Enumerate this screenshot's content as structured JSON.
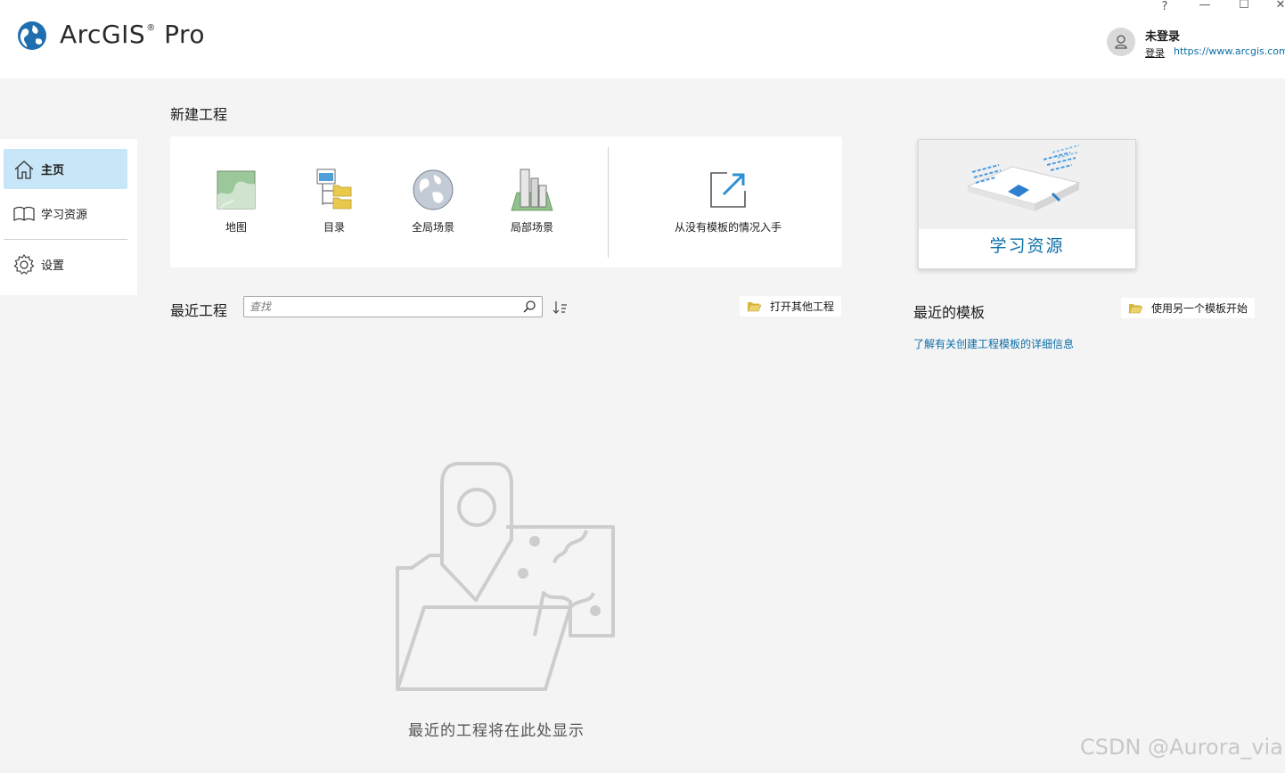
{
  "app": {
    "brand": "ArcGIS",
    "brand_mark": "®",
    "brand_suffix": "Pro"
  },
  "window": {
    "help": "?",
    "minimize": "—",
    "maximize": "☐",
    "close": "✕"
  },
  "user": {
    "status": "未登录",
    "login": "登录",
    "portal": "https://www.arcgis.com/"
  },
  "sidebar": {
    "items": [
      {
        "label": "主页",
        "icon": "home-icon"
      },
      {
        "label": "学习资源",
        "icon": "book-icon"
      },
      {
        "label": "设置",
        "icon": "gear-icon"
      }
    ]
  },
  "new_project": {
    "title": "新建工程",
    "templates": [
      {
        "label": "地图",
        "icon": "map-icon"
      },
      {
        "label": "目录",
        "icon": "catalog-icon"
      },
      {
        "label": "全局场景",
        "icon": "globe-icon"
      },
      {
        "label": "局部场景",
        "icon": "local-scene-icon"
      },
      {
        "label": "从没有模板的情况入手",
        "icon": "external-arrow-icon"
      }
    ]
  },
  "learning": {
    "label": "学习资源"
  },
  "recent_projects": {
    "title": "最近工程",
    "search_placeholder": "查找",
    "open_other": "打开其他工程",
    "empty_text": "最近的工程将在此处显示"
  },
  "recent_templates": {
    "title": "最近的模板",
    "use_another": "使用另一个模板开始",
    "learn_more": "了解有关创建工程模板的详细信息"
  },
  "watermark": "CSDN @Aurora_via"
}
